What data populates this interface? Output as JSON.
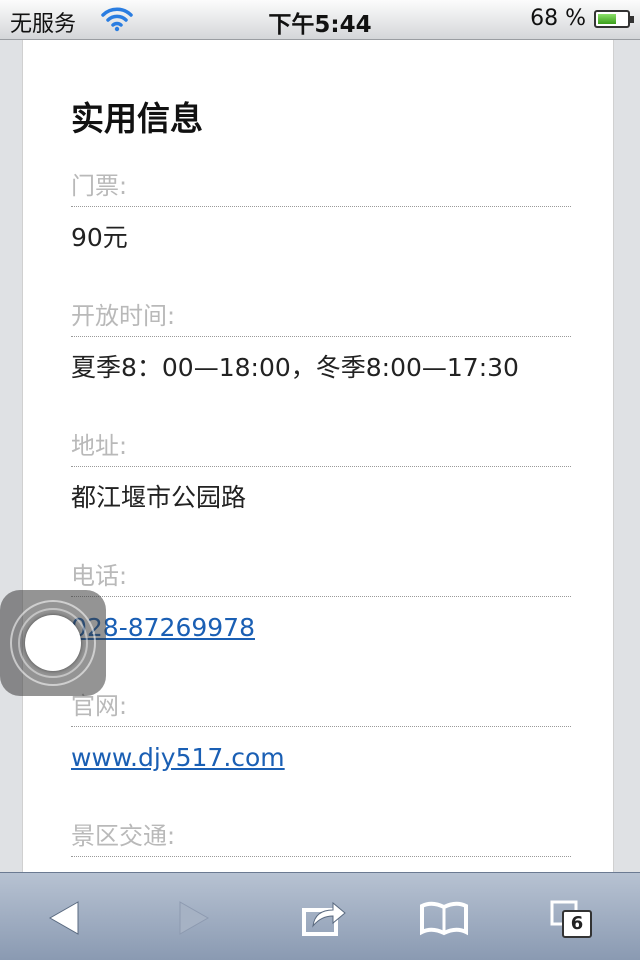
{
  "status_bar": {
    "carrier": "无服务",
    "time": "下午5:44",
    "battery_percent": "68 %",
    "battery_level": 0.68
  },
  "section": {
    "title": "实用信息"
  },
  "info": [
    {
      "label": "门票:",
      "value": "90元"
    },
    {
      "label": "开放时间:",
      "value": "夏季8：00—18:00，冬季8:00—17:30"
    },
    {
      "label": "地址:",
      "value": "都江堰市公园路"
    },
    {
      "label": "电话:",
      "value": "028-87269978"
    },
    {
      "label": "官网:",
      "value": "www.djy517.com"
    },
    {
      "label": "景区交通:",
      "value": ""
    }
  ],
  "toolbar": {
    "back_icon": "back-arrow-icon",
    "forward_icon": "forward-arrow-icon",
    "share_icon": "share-icon",
    "bookmarks_icon": "bookmarks-icon",
    "tabs_icon": "tabs-icon",
    "tabs_count": "6"
  },
  "colors": {
    "link": "#1a5fb4",
    "label": "#b9b9b9",
    "toolbar": "#9aa8bd"
  }
}
